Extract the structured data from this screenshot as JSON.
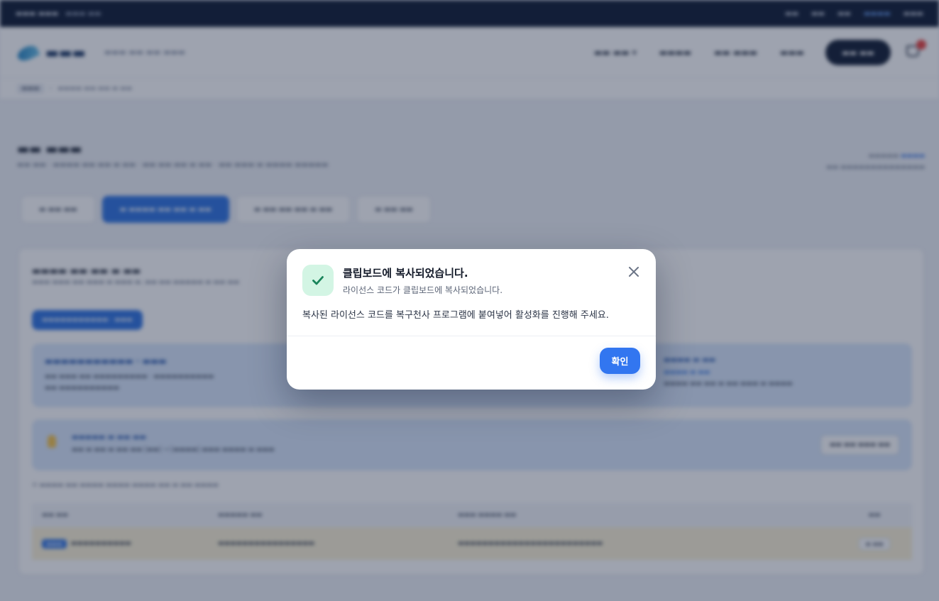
{
  "dialog": {
    "title": "클립보드에 복사되었습니다.",
    "subtitle": "라이선스 코드가 클립보드에 복사되었습니다.",
    "body": "복사된 라이선스 코드를 복구천사 프로그램에 붙여넣어 활성화를 진행해 주세요.",
    "confirm_label": "확인",
    "icon": "check-icon",
    "close_icon": "close-icon"
  },
  "colors": {
    "primary": "#3276f0",
    "success_bg": "#d3f5e4",
    "success_check": "#18845a",
    "overlay": "rgba(24, 36, 64, 0.42)"
  }
}
